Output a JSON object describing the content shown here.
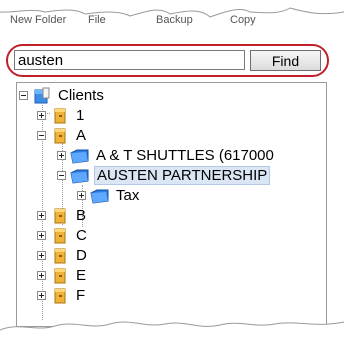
{
  "tabs": [
    "New Folder",
    "File",
    "Backup",
    "Copy"
  ],
  "search": {
    "value": "austen",
    "button_label": "Find"
  },
  "tree": {
    "root": {
      "label": "Clients",
      "expanded": true
    },
    "items": [
      {
        "label": "1",
        "expanded": false
      },
      {
        "label": "A",
        "expanded": true
      },
      {
        "label": "A & T SHUTTLES (617000",
        "expanded": false
      },
      {
        "label": "AUSTEN PARTNERSHIP",
        "expanded": true,
        "selected": true
      },
      {
        "label": "Tax",
        "expanded": false
      },
      {
        "label": "B",
        "expanded": false
      },
      {
        "label": "C",
        "expanded": false
      },
      {
        "label": "D",
        "expanded": false
      },
      {
        "label": "E",
        "expanded": false
      },
      {
        "label": "F",
        "expanded": false
      }
    ]
  },
  "colors": {
    "highlight_oval": "#c0202a",
    "selection": "#dbe6f5",
    "folder_blue": "#2a7de1",
    "cabinet_gold": "#f0b23a"
  }
}
